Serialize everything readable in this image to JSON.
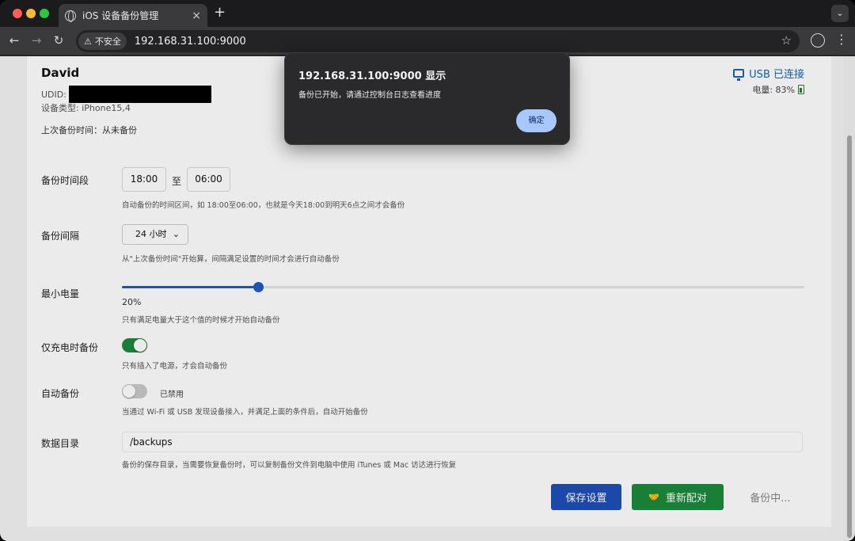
{
  "browser": {
    "tab_title": "iOS 设备备份管理",
    "tab_close": "×",
    "new_tab": "+",
    "tab_menu": "⌄",
    "security_label": "不安全",
    "security_icon": "⚠",
    "url": "192.168.31.100:9000",
    "back": "←",
    "forward": "→",
    "reload": "↻",
    "star": "☆",
    "menu": "⋮"
  },
  "device": {
    "name": "David",
    "udid_label": "UDID:",
    "type": "设备类型: iPhone15,4",
    "last_backup": "上次备份时间：从未备份",
    "connection": "USB 已连接",
    "battery": "电量: 83%"
  },
  "settings": {
    "period": {
      "label": "备份时间段",
      "start": "18:00",
      "separator": "至",
      "end": "06:00",
      "hint": "自动备份的时间区间，如 18:00至06:00，也就是今天18:00到明天6点之间才会备份"
    },
    "interval": {
      "label": "备份间隔",
      "value": "24 小时",
      "hint": "从\"上次备份时间\"开始算，间隔满足设置的时间才会进行自动备份"
    },
    "min_battery": {
      "label": "最小电量",
      "value": 20,
      "value_text": "20%",
      "hint": "只有满足电量大于这个值的时候才开始自动备份"
    },
    "charging_only": {
      "label": "仅充电时备份",
      "enabled": true,
      "hint": "只有插入了电源，才会自动备份"
    },
    "auto_backup": {
      "label": "自动备份",
      "enabled": false,
      "state_text": "已禁用",
      "hint": "当通过 Wi-Fi 或 USB 发现设备接入，并满足上面的条件后，自动开始备份"
    },
    "data_dir": {
      "label": "数据目录",
      "value": "/backups",
      "hint": "备份的保存目录，当需要恢复备份时，可以复制备份文件到电脑中使用 iTunes 或 Mac 访达进行恢复"
    }
  },
  "actions": {
    "save": "保存设置",
    "repair": "重新配对",
    "backing_up": "备份中..."
  },
  "dialog": {
    "title": "192.168.31.100:9000 显示",
    "message": "备份已开始，请通过控制台日志查看进度",
    "ok": "确定"
  },
  "colors": {
    "primary": "#1f4fb8",
    "success": "#1c8a3c",
    "link": "#1565c0"
  }
}
